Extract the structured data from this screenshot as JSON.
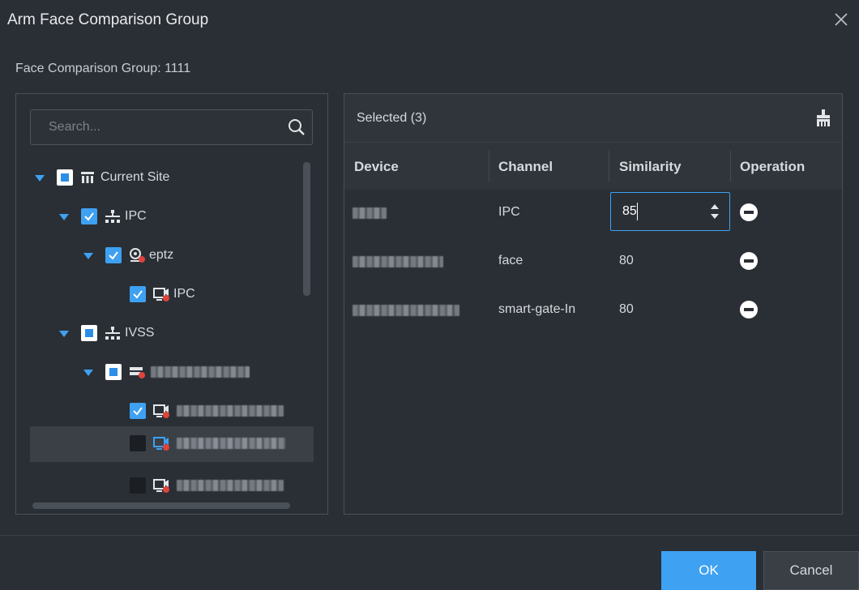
{
  "dialog": {
    "title": "Arm Face Comparison Group",
    "group_line": "Face Comparison Group:  1111",
    "ok_label": "OK",
    "cancel_label": "Cancel"
  },
  "search": {
    "placeholder": "Search..."
  },
  "tree": {
    "nodes": [
      {
        "label": "Current Site",
        "checkbox": "partial",
        "icon": "site-icon",
        "expanded": true
      },
      {
        "label": "IPC",
        "checkbox": "checked",
        "icon": "network-icon",
        "expanded": true
      },
      {
        "label": "eptz",
        "checkbox": "checked",
        "icon": "device-icon",
        "expanded": true
      },
      {
        "label": "IPC",
        "checkbox": "checked",
        "icon": "channel-icon"
      },
      {
        "label": "IVSS",
        "checkbox": "partial",
        "icon": "network-icon",
        "expanded": true
      },
      {
        "label": "",
        "checkbox": "partial",
        "icon": "nvr-icon",
        "expanded": true
      },
      {
        "label": "",
        "checkbox": "checked",
        "icon": "channel-icon"
      },
      {
        "label": "",
        "checkbox": "empty",
        "icon": "channel-icon",
        "highlighted": true
      },
      {
        "label": "",
        "checkbox": "empty",
        "icon": "channel-icon"
      }
    ]
  },
  "selected": {
    "title": "Selected (3)",
    "columns": [
      "Device",
      "Channel",
      "Similarity",
      "Operation"
    ],
    "rows": [
      {
        "device": "",
        "channel": "IPC",
        "similarity": "85",
        "editing": true
      },
      {
        "device": "",
        "channel": "face",
        "similarity": "80"
      },
      {
        "device": "",
        "channel": "smart-gate-In",
        "similarity": "80"
      }
    ]
  },
  "colors": {
    "accent": "#3ea1f2",
    "background": "#2a2f35",
    "header": "#30353b"
  }
}
